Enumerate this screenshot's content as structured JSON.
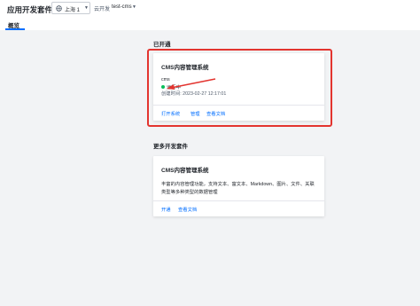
{
  "header": {
    "app_title": "应用开发套件",
    "region": "上海 1",
    "env_label": "云开发",
    "env_value": "test-cms",
    "tab_overview": "概览"
  },
  "enabled_section": {
    "title": "已开通",
    "card": {
      "title": "CMS内容管理系统",
      "instance": "cms",
      "status": "运行中",
      "created": "创建时间:  2023-02-27 12:17:01",
      "links": [
        "打开系统",
        "管理",
        "查看文档"
      ]
    }
  },
  "more_section": {
    "title": "更多开发套件",
    "card": {
      "title": "CMS内容管理系统",
      "description": "丰富的内容管理功能，支持文本、富文本、Markdown、图片、文件、关联类型等多种类型的数据管理",
      "links": [
        "开通",
        "查看文档"
      ]
    }
  },
  "colors": {
    "accent": "#006eff",
    "status_running": "#0abf5b",
    "annotation": "#e3342f"
  },
  "icons": [
    "globe-icon",
    "chevron-down-icon",
    "status-dot-icon",
    "annotation-arrow-icon"
  ]
}
